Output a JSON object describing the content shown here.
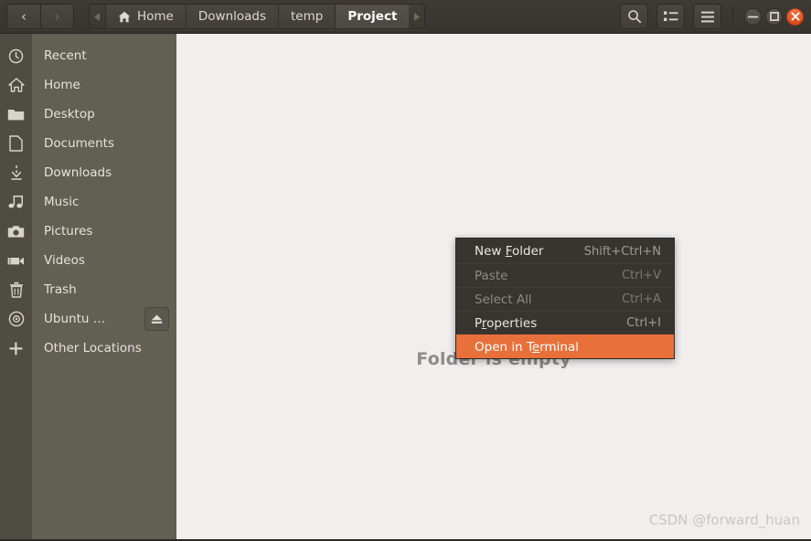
{
  "window": {
    "nav": {
      "back_label": "‹",
      "forward_label": "›",
      "back_icon": "chevron-left-icon",
      "forward_icon": "chevron-right-icon"
    },
    "breadcrumbs": {
      "left_arrow": "◀",
      "right_arrow": "▶",
      "items": [
        {
          "label": "Home",
          "icon": "home-icon",
          "active": false
        },
        {
          "label": "Downloads",
          "icon": "",
          "active": false
        },
        {
          "label": "temp",
          "icon": "",
          "active": false
        },
        {
          "label": "Project",
          "icon": "",
          "active": true
        }
      ]
    },
    "toolbar_buttons": [
      {
        "name": "search-button",
        "icon": "search-icon"
      },
      {
        "name": "view-options-button",
        "icon": "list-view-icon"
      },
      {
        "name": "main-menu-button",
        "icon": "hamburger-menu-icon"
      }
    ],
    "controls": {
      "minimize": "minimize-icon",
      "maximize": "maximize-icon",
      "close": "close-icon",
      "close_glyph": "×"
    }
  },
  "sidebar": {
    "items": [
      {
        "label": "Recent",
        "icon": "clock-icon",
        "name": "sidebar-item-recent"
      },
      {
        "label": "Home",
        "icon": "home-icon",
        "name": "sidebar-item-home"
      },
      {
        "label": "Desktop",
        "icon": "folder-icon",
        "name": "sidebar-item-desktop"
      },
      {
        "label": "Documents",
        "icon": "document-icon",
        "name": "sidebar-item-documents"
      },
      {
        "label": "Downloads",
        "icon": "download-icon",
        "name": "sidebar-item-downloads"
      },
      {
        "label": "Music",
        "icon": "music-note-icon",
        "name": "sidebar-item-music"
      },
      {
        "label": "Pictures",
        "icon": "camera-icon",
        "name": "sidebar-item-pictures"
      },
      {
        "label": "Videos",
        "icon": "video-camera-icon",
        "name": "sidebar-item-videos"
      },
      {
        "label": "Trash",
        "icon": "trash-icon",
        "name": "sidebar-item-trash"
      },
      {
        "label": "Ubuntu …",
        "icon": "disc-icon",
        "name": "sidebar-item-ubuntu-disc",
        "eject": true
      },
      {
        "label": "Other Locations",
        "icon": "plus-icon",
        "name": "sidebar-item-other-locations"
      }
    ],
    "eject_icon": "eject-icon"
  },
  "main": {
    "empty_text": "Folder is empty",
    "watermark": "CSDN @forward_huan"
  },
  "context_menu": {
    "items": [
      {
        "label_pre": "New ",
        "label_mn": "F",
        "label_post": "older",
        "accel": "Shift+Ctrl+N",
        "state": "normal",
        "name": "menu-item-new-folder"
      },
      {
        "label_pre": "Paste",
        "label_mn": "",
        "label_post": "",
        "accel": "Ctrl+V",
        "state": "disabled",
        "name": "menu-item-paste"
      },
      {
        "label_pre": "Select All",
        "label_mn": "",
        "label_post": "",
        "accel": "Ctrl+A",
        "state": "disabled",
        "name": "menu-item-select-all"
      },
      {
        "label_pre": "P",
        "label_mn": "r",
        "label_post": "operties",
        "accel": "Ctrl+I",
        "state": "normal",
        "name": "menu-item-properties"
      },
      {
        "label_pre": "Open in T",
        "label_mn": "e",
        "label_post": "rminal",
        "accel": "",
        "state": "highlight",
        "name": "menu-item-open-in-terminal"
      }
    ]
  },
  "colors": {
    "headerbar": "#3a3732",
    "sidebar": "#625f53",
    "sidebar_icons": "#4f4c43",
    "main_bg": "#f0efee",
    "menu_bg": "#383531",
    "highlight": "#e8703a",
    "close_button": "#dd4814"
  }
}
